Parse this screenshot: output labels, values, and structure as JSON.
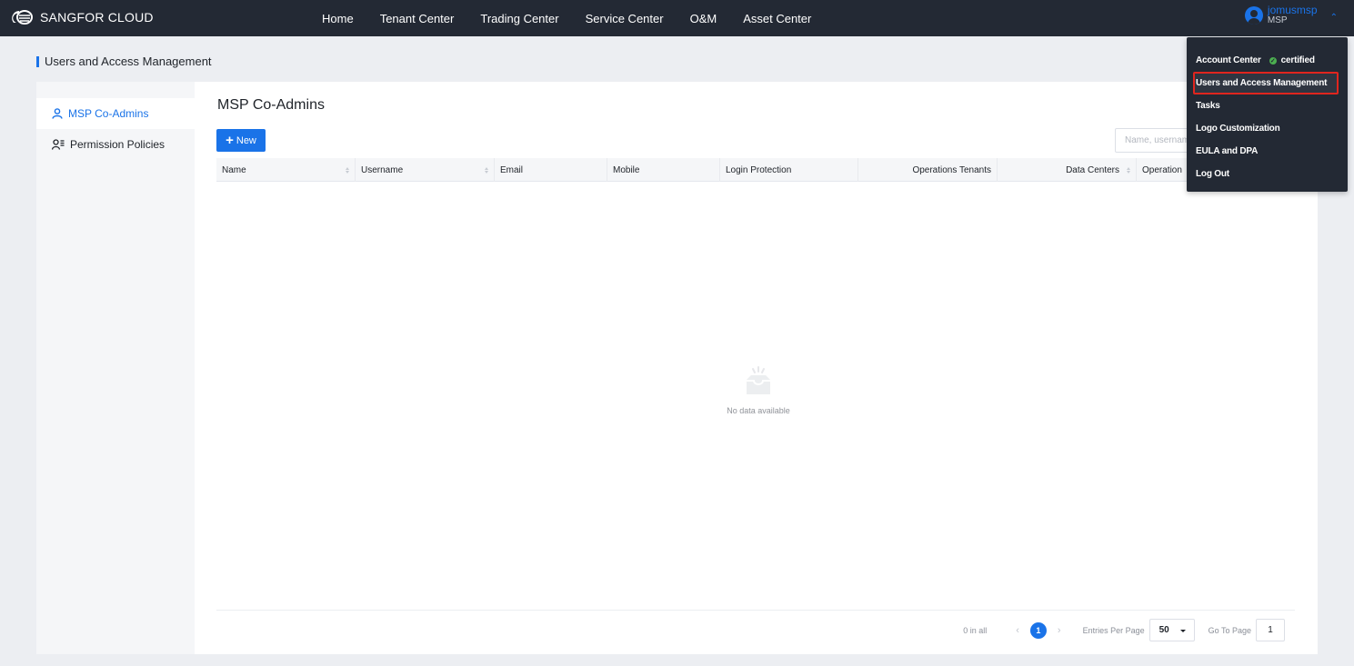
{
  "header": {
    "brand": "SANGFOR CLOUD",
    "nav": [
      "Home",
      "Tenant Center",
      "Trading Center",
      "Service Center",
      "O&M",
      "Asset Center"
    ],
    "user": {
      "name": "jomusmsp",
      "role": "MSP"
    }
  },
  "page": {
    "title": "Users and Access Management"
  },
  "sidebar": {
    "items": [
      {
        "label": "MSP Co-Admins",
        "icon": "user-icon",
        "active": true
      },
      {
        "label": "Permission Policies",
        "icon": "user-list-icon",
        "active": false
      }
    ]
  },
  "main": {
    "title": "MSP Co-Admins",
    "new_label": "New",
    "search_placeholder": "Name, username",
    "columns": [
      {
        "label": "Name",
        "sortable": true
      },
      {
        "label": "Username",
        "sortable": true
      },
      {
        "label": "Email",
        "sortable": false
      },
      {
        "label": "Mobile",
        "sortable": false
      },
      {
        "label": "Login Protection",
        "sortable": false
      },
      {
        "label": "Operations Tenants",
        "sortable": false
      },
      {
        "label": "Data Centers",
        "sortable": true
      },
      {
        "label": "Operation",
        "sortable": false
      }
    ],
    "rows": [],
    "empty_text": "No data available"
  },
  "pagination": {
    "total": "0 in all",
    "current_page": "1",
    "entries_label": "Entries Per Page",
    "entries_value": "50",
    "goto_label": "Go To Page",
    "goto_value": "1"
  },
  "user_menu": {
    "items": [
      {
        "label": "Account Center",
        "badge": "certified"
      },
      {
        "label": "Users and Access Management",
        "highlighted": true
      },
      {
        "label": "Tasks"
      },
      {
        "label": "Logo Customization"
      },
      {
        "label": "EULA and DPA"
      },
      {
        "label": "Log Out"
      }
    ]
  },
  "colors": {
    "accent": "#1a73e8",
    "topbar": "#232934",
    "highlight_border": "#e0251e",
    "certified": "#4caf50"
  }
}
